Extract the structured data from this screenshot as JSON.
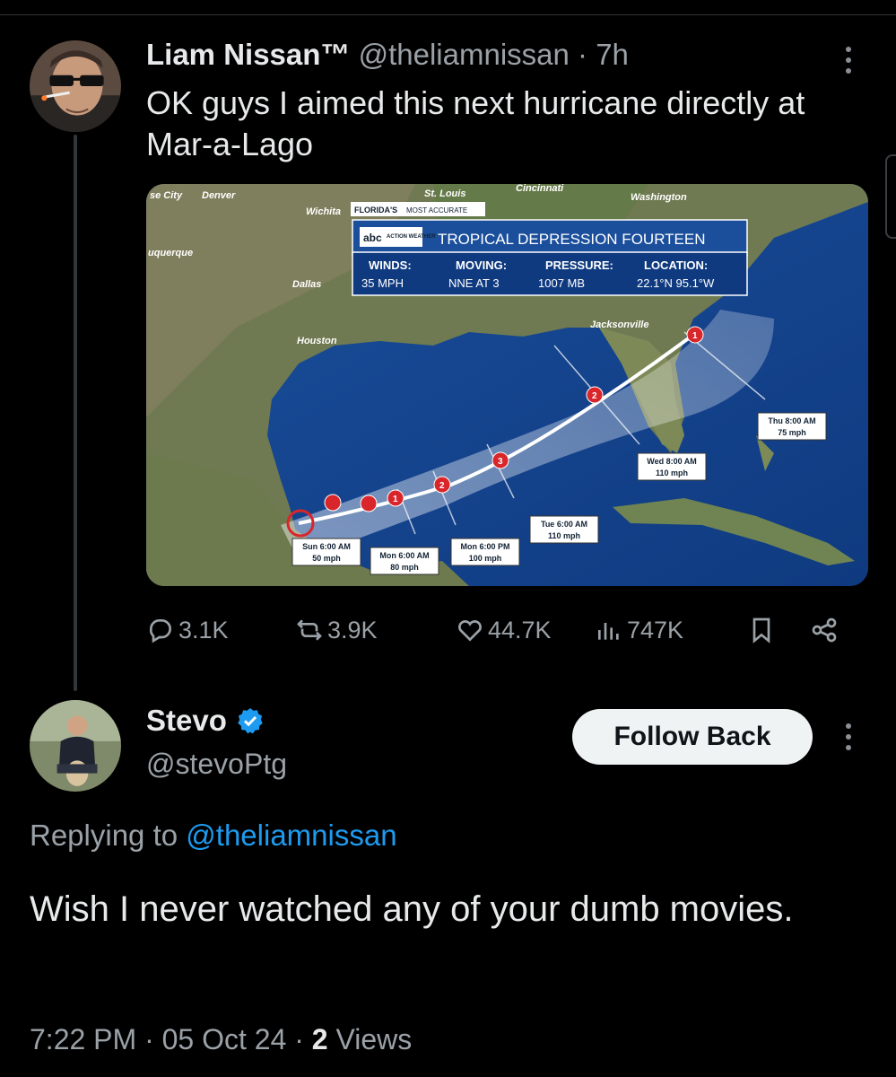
{
  "tweet": {
    "display_name": "Liam Nissan™",
    "handle": "@theliamnissan",
    "time": "· 7h",
    "text": "OK guys I aimed this next hurricane directly at Mar-a-Lago",
    "media": {
      "banner_top": "FLORIDA'S",
      "banner_sub": "MOST ACCURATE",
      "headline": "TROPICAL DEPRESSION FOURTEEN",
      "logo_main": "abc",
      "logo_sub": "ACTION WEATHER",
      "stats": [
        {
          "label": "WINDS:",
          "value": "35 MPH"
        },
        {
          "label": "MOVING:",
          "value": "NNE AT 3"
        },
        {
          "label": "PRESSURE:",
          "value": "1007 MB"
        },
        {
          "label": "LOCATION:",
          "value": "22.1°N  95.1°W"
        }
      ],
      "cities": [
        "Denver",
        "Wichita",
        "St. Louis",
        "Cincinnati",
        "Washington",
        "Dallas",
        "Houston",
        "Jacksonville",
        "uquerque",
        "se City"
      ],
      "track_labels": [
        {
          "line1": "Sun 6:00 AM",
          "line2": "50 mph"
        },
        {
          "line1": "Mon 6:00 AM",
          "line2": "80 mph"
        },
        {
          "line1": "Mon 6:00 PM",
          "line2": "100 mph"
        },
        {
          "line1": "Tue 6:00 AM",
          "line2": "110 mph"
        },
        {
          "line1": "Wed 8:00 AM",
          "line2": "110 mph"
        },
        {
          "line1": "Thu 8:00 AM",
          "line2": "75 mph"
        }
      ],
      "storm_cats": [
        "1",
        "2",
        "3",
        "2",
        "1"
      ]
    },
    "stats": {
      "replies": "3.1K",
      "reposts": "3.9K",
      "likes": "44.7K",
      "views": "747K"
    }
  },
  "reply": {
    "display_name": "Stevo",
    "handle": "@stevoPtg",
    "follow_label": "Follow Back",
    "replying_prefix": "Replying to",
    "replying_handle": "@theliamnissan",
    "text": "Wish I never watched any of your dumb movies.",
    "time": "7:22 PM · 05 Oct 24 ·",
    "views_count": "2",
    "views_label": "Views"
  },
  "colors": {
    "link": "#1d9bf0",
    "verified": "#1d9bf0",
    "muted": "#9aa1a7",
    "text": "#e7e9ea",
    "follow_bg": "#eff3f4",
    "storm_red": "#d9262b"
  }
}
